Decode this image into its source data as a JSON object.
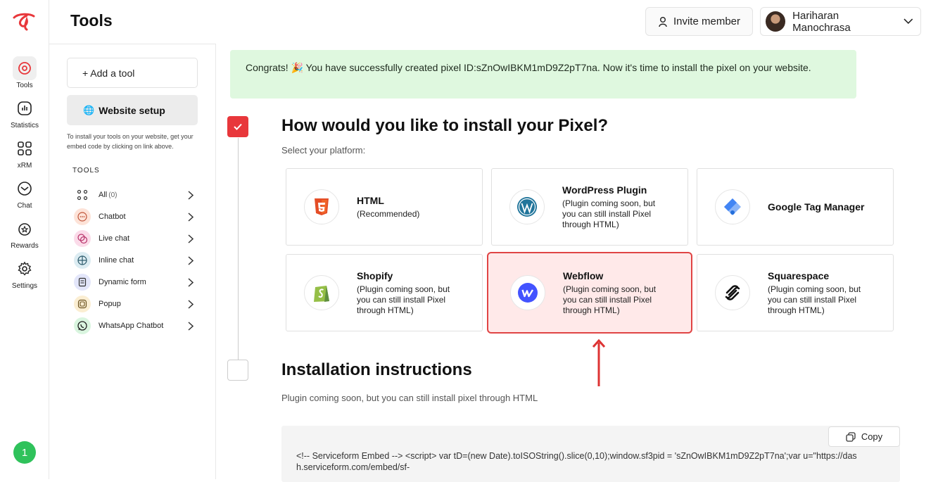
{
  "app": {
    "page_title": "Tools"
  },
  "header": {
    "invite_label": "Invite member",
    "user_name": "Hariharan Manochrasa"
  },
  "rail": {
    "items": [
      {
        "label": "Tools",
        "icon": "tools-icon",
        "active": true
      },
      {
        "label": "Statistics",
        "icon": "statistics-icon"
      },
      {
        "label": "xRM",
        "icon": "grid-icon"
      },
      {
        "label": "Chat",
        "icon": "chat-icon"
      },
      {
        "label": "Rewards",
        "icon": "rewards-icon"
      },
      {
        "label": "Settings",
        "icon": "gear-icon"
      }
    ],
    "notification_count": "1"
  },
  "panel": {
    "add_tool_label": "+ Add a tool",
    "website_setup_label": "Website setup",
    "help_text": "To install your tools on your website, get your embed code by clicking on link above.",
    "tools_heading": "TOOLS",
    "tools": [
      {
        "label": "All",
        "count": "(0)",
        "icon": "apps-icon"
      },
      {
        "label": "Chatbot",
        "icon": "chatbot-icon",
        "color": "#fde3d8"
      },
      {
        "label": "Live chat",
        "icon": "live-chat-icon",
        "color": "#fbdbe9"
      },
      {
        "label": "Inline chat",
        "icon": "inline-chat-icon",
        "color": "#dcecf2"
      },
      {
        "label": "Dynamic form",
        "icon": "form-icon",
        "color": "#e3e6fa"
      },
      {
        "label": "Popup",
        "icon": "popup-icon",
        "color": "#fbeed2"
      },
      {
        "label": "WhatsApp Chatbot",
        "icon": "whatsapp-icon",
        "color": "#d9f5df"
      }
    ]
  },
  "banner": {
    "text": "Congrats! 🎉 You have successfully created pixel ID:sZnOwIBKM1mD9Z2pT7na. Now it's time to install the pixel on your website."
  },
  "install": {
    "heading": "How would you like to install your Pixel?",
    "subheading": "Select your platform:",
    "platforms": [
      {
        "title": "HTML",
        "desc": "(Recommended)",
        "icon": "html5-icon"
      },
      {
        "title": "WordPress Plugin",
        "desc": "(Plugin coming soon, but you can still install Pixel through HTML)",
        "icon": "wordpress-icon"
      },
      {
        "title": "Google Tag Manager",
        "desc": "",
        "icon": "google-tag-manager-icon"
      },
      {
        "title": "Shopify",
        "desc": "(Plugin coming soon, but you can still install Pixel through HTML)",
        "icon": "shopify-icon"
      },
      {
        "title": "Webflow",
        "desc": "(Plugin coming soon, but you can still install Pixel through HTML)",
        "icon": "webflow-icon",
        "selected": true
      },
      {
        "title": "Squarespace",
        "desc": "(Plugin coming soon, but you can still install Pixel through HTML)",
        "icon": "squarespace-icon"
      }
    ]
  },
  "instructions": {
    "heading": "Installation instructions",
    "subheading": "Plugin coming soon, but you can still install pixel through HTML",
    "copy_label": "Copy",
    "code": "<!-- Serviceform Embed --> <script> var tD=(new Date).toISOString().slice(0,10);window.sf3pid = 'sZnOwIBKM1mD9Z2pT7na';var u=\"https://dash.serviceform.com/embed/sf-"
  },
  "colors": {
    "accent": "#e8373b",
    "banner_bg": "#dff8df",
    "selected_bg": "#ffe9e9"
  }
}
